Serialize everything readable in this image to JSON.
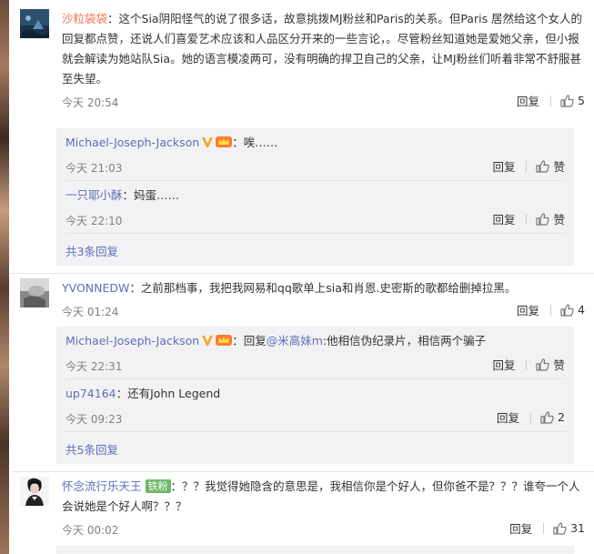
{
  "comments": [
    {
      "user": "沙粒袋袋",
      "text": "：这个Sia阴阳怪气的说了很多话，故意挑拨MJ粉丝和Paris的关系。但Paris 居然给这个女人的回复都点赞，还说人们喜爱艺术应该和人品区分开来的一些言论，。尽管粉丝知道她是爱她父亲，但小报就会解读为她站队Sia。她的语言模凌两可，没有明确的捍卫自己的父亲，让MJ粉丝们听着非常不舒服甚至失望。",
      "time": "今天 20:54",
      "reply_label": "回复",
      "likes": "5",
      "replies": [
        {
          "user": "Michael-Joseph-Jackson",
          "text": "：唉……",
          "time": "今天 21:03",
          "reply_label": "回复",
          "likes": "赞"
        },
        {
          "user": "一只耶小酥",
          "text": "：妈蛋……",
          "time": "今天 22:10",
          "reply_label": "回复",
          "likes": "赞"
        }
      ],
      "more": "共3条回复"
    },
    {
      "user": "YVONNEDW",
      "text": "：之前那档事，我把我网易和qq歌单上sia和肖恩.史密斯的歌都给删掉拉黑。",
      "time": "今天 01:24",
      "reply_label": "回复",
      "likes": "4",
      "replies": [
        {
          "user": "Michael-Joseph-Jackson",
          "text_prefix": "：回复",
          "mention": "@米高妹m",
          "text": ":他相信伪纪录片，相信两个骗子",
          "time": "今天 22:31",
          "reply_label": "回复",
          "likes": "赞"
        },
        {
          "user": "up74164",
          "text": "：还有John Legend",
          "time": "今天 09:23",
          "reply_label": "回复",
          "likes": "2"
        }
      ],
      "more": "共5条回复"
    },
    {
      "user": "怀念流行乐天王",
      "tag": "铁粉",
      "text": "：？？我觉得她隐含的意思是，我相信你是个好人，但你爸不是？？？谁夸一个人会说她是个好人啊？？？",
      "time": "今天 00:02",
      "reply_label": "回复",
      "likes": "31"
    }
  ],
  "icons": {
    "like": "thumbs-up-icon",
    "verified": "verified-v-icon",
    "member": "member-crown-icon"
  },
  "colors": {
    "username": "#eb7350",
    "link": "#5d6fb6",
    "reply_bg": "#f2f2f5",
    "verified": "#f6a623"
  }
}
